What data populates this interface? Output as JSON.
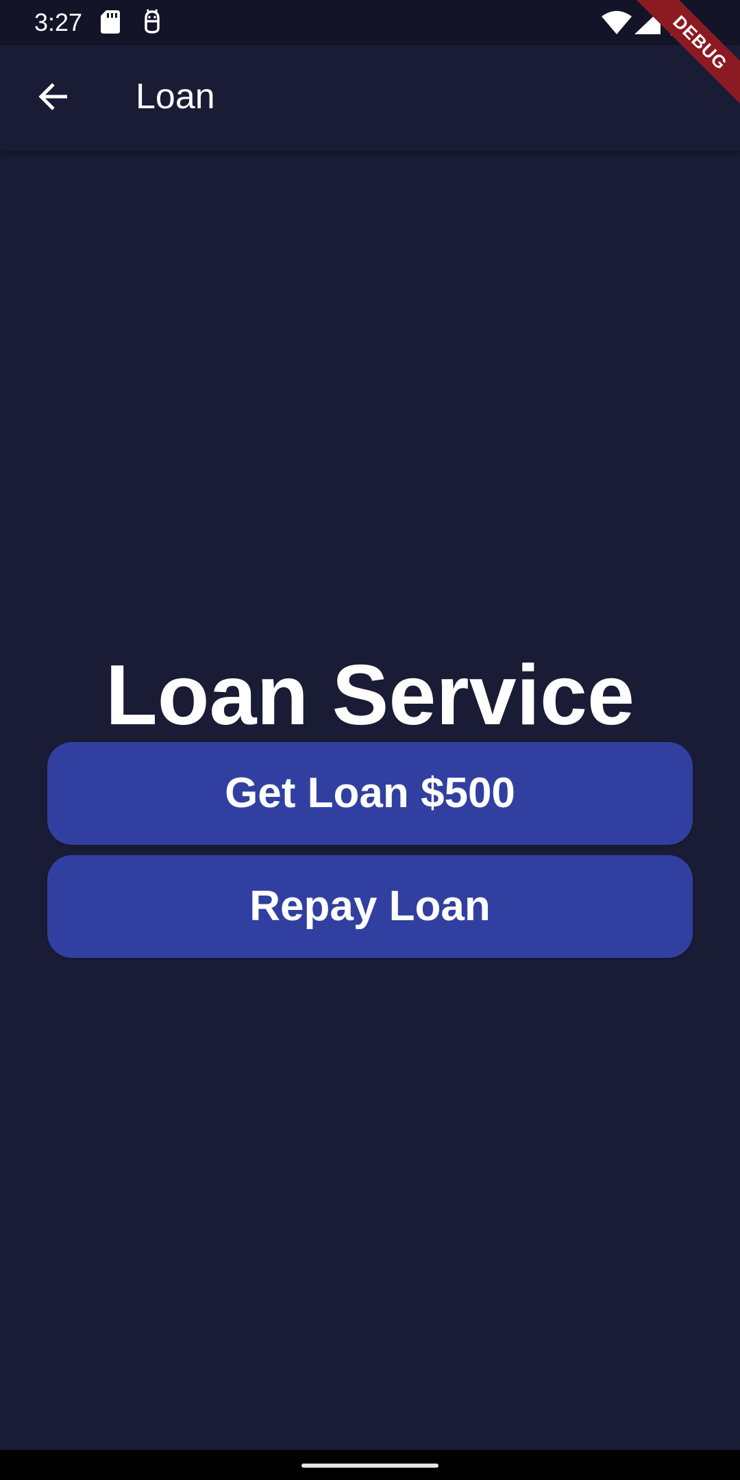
{
  "status_bar": {
    "time": "3:27",
    "icons": [
      "sd-card-icon",
      "debug-android-icon",
      "wifi-icon",
      "signal-icon",
      "battery-icon"
    ]
  },
  "app_bar": {
    "back_icon": "arrow-back-icon",
    "title": "Loan"
  },
  "debug_banner": {
    "label": "DEBUG",
    "color": "#8b1a22"
  },
  "main": {
    "title": "Loan Service",
    "buttons": [
      {
        "label": "Get Loan $500"
      },
      {
        "label": "Repay Loan"
      }
    ]
  },
  "colors": {
    "background": "#1a1c36",
    "status_bar": "#131428",
    "button": "#3140a0",
    "text": "#ffffff"
  }
}
